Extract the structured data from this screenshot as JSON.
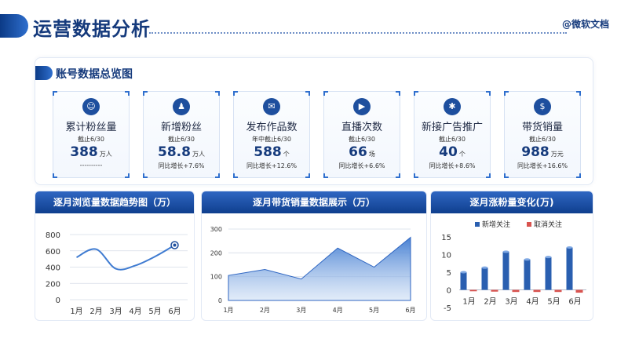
{
  "header": {
    "title": "运营数据分析",
    "brand": "@微软文档"
  },
  "overview": {
    "title": "账号数据总览图",
    "kpis": [
      {
        "icon": "users-icon",
        "glyph": "☺",
        "label": "累计粉丝量",
        "date": "截止6/30",
        "value": "388",
        "unit": "万人",
        "growth": "----------"
      },
      {
        "icon": "new-fans-icon",
        "glyph": "♟",
        "label": "新增粉丝",
        "date": "截止6/30",
        "value": "58.8",
        "unit": "万人",
        "growth": "同比增长+7.6%"
      },
      {
        "icon": "publish-icon",
        "glyph": "✉",
        "label": "发布作品数",
        "date": "年中截止6/30",
        "value": "588",
        "unit": "个",
        "growth": "同比增长+12.6%"
      },
      {
        "icon": "live-icon",
        "glyph": "▶",
        "label": "直播次数",
        "date": "截止6/30",
        "value": "66",
        "unit": "场",
        "growth": "同比增长+6.6%"
      },
      {
        "icon": "ad-icon",
        "glyph": "✱",
        "label": "新接广告推广",
        "date": "截止6/30",
        "value": "40",
        "unit": "个",
        "growth": "同比增长+8.6%"
      },
      {
        "icon": "sales-icon",
        "glyph": "$",
        "label": "带货销量",
        "date": "截止6/30",
        "value": "988",
        "unit": "万元",
        "growth": "同比增长+16.6%"
      }
    ]
  },
  "chart_data": [
    {
      "type": "line",
      "title": "逐月浏览量数据趋势图（万）",
      "categories": [
        "1月",
        "2月",
        "3月",
        "4月",
        "5月",
        "6月"
      ],
      "values": [
        520,
        620,
        380,
        420,
        530,
        670
      ],
      "ylim": [
        0,
        800
      ],
      "yticks": [
        0,
        200,
        400,
        600,
        800
      ],
      "color": "#3f7bd1"
    },
    {
      "type": "area",
      "title": "逐月带货销量数据展示（万）",
      "categories": [
        "1月",
        "2月",
        "3月",
        "4月",
        "5月",
        "6月"
      ],
      "values": [
        105,
        130,
        90,
        220,
        140,
        265
      ],
      "ylim": [
        0,
        300
      ],
      "yticks": [
        0,
        100,
        200,
        300
      ],
      "color": "#3f7bd1"
    },
    {
      "type": "bar",
      "title": "逐月涨粉量变化(万)",
      "categories": [
        "1月",
        "2月",
        "3月",
        "4月",
        "5月",
        "6月"
      ],
      "ylim": [
        -5,
        15
      ],
      "yticks": [
        -5,
        0,
        5,
        10,
        15
      ],
      "legend": "top",
      "series": [
        {
          "name": "新增关注",
          "values": [
            5,
            6.3,
            10.8,
            8.6,
            9.3,
            12
          ],
          "color": "#2a5fb0"
        },
        {
          "name": "取消关注",
          "values": [
            -0.4,
            -0.5,
            -0.6,
            -0.6,
            -0.6,
            -0.8
          ],
          "color": "#d9534f"
        }
      ]
    }
  ]
}
